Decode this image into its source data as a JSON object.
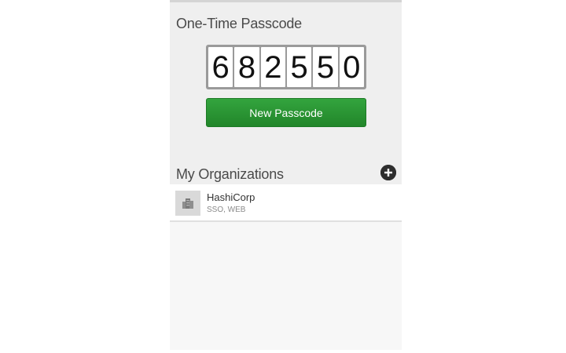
{
  "otp": {
    "title": "One-Time Passcode",
    "digits": [
      "6",
      "8",
      "2",
      "5",
      "5",
      "0"
    ],
    "new_button_label": "New Passcode",
    "button_color": "#2a9634"
  },
  "organizations": {
    "title": "My Organizations",
    "add_icon": "plus-circle-icon",
    "items": [
      {
        "name": "HashiCorp",
        "types": "SSO, WEB",
        "icon": "building-icon"
      }
    ]
  }
}
